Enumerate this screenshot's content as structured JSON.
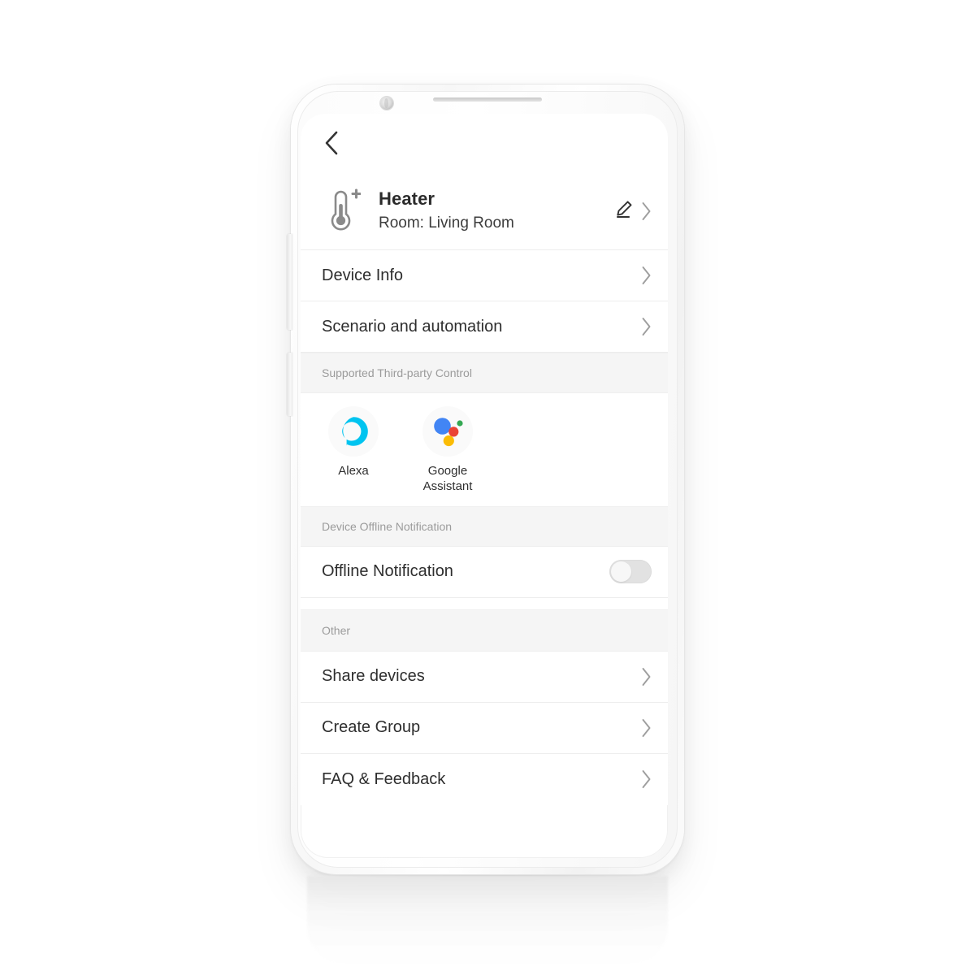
{
  "background_color": "#ffffff",
  "phone": {
    "hardware": {
      "earpiece": "earpiece-speaker",
      "camera": "front-camera",
      "volume_button": "volume-rocker",
      "power_button": "power-button"
    }
  },
  "screen": {
    "navbar": {
      "back_icon": "back-chevron-icon"
    },
    "device_header": {
      "icon": "thermometer-plus-icon",
      "name": "Heater",
      "room": "Room: Living Room",
      "edit_icon": "pencil-edit-icon",
      "chevron_icon": "chevron-right-icon"
    },
    "menu_rows": [
      {
        "label": "Device Info",
        "chevron": "chevron-right-icon"
      },
      {
        "label": "Scenario and automation",
        "chevron": "chevron-right-icon"
      }
    ],
    "third_party": {
      "section_title": "Supported Third-party Control",
      "items": [
        {
          "name": "Alexa",
          "icon": "alexa-icon",
          "color": "#00C4F0"
        },
        {
          "name": "Google\nAssistant",
          "name_line1": "Google",
          "name_line2": "Assistant",
          "icon": "google-assistant-icon",
          "colors": {
            "blue": "#4285F4",
            "red": "#EA4335",
            "yellow": "#FBBC05",
            "green": "#34A853"
          }
        }
      ]
    },
    "offline": {
      "section_title": "Device Offline Notification",
      "row_label": "Offline Notification",
      "toggle_state": "off",
      "toggle_track_color": "#e2e2e2",
      "toggle_knob_color": "#f7f7f7"
    },
    "other": {
      "section_title": "Other",
      "rows": [
        {
          "label": "Share devices",
          "chevron": "chevron-right-icon"
        },
        {
          "label": "Create Group",
          "chevron": "chevron-right-icon"
        },
        {
          "label": "FAQ & Feedback",
          "chevron": "chevron-right-icon"
        }
      ]
    }
  }
}
